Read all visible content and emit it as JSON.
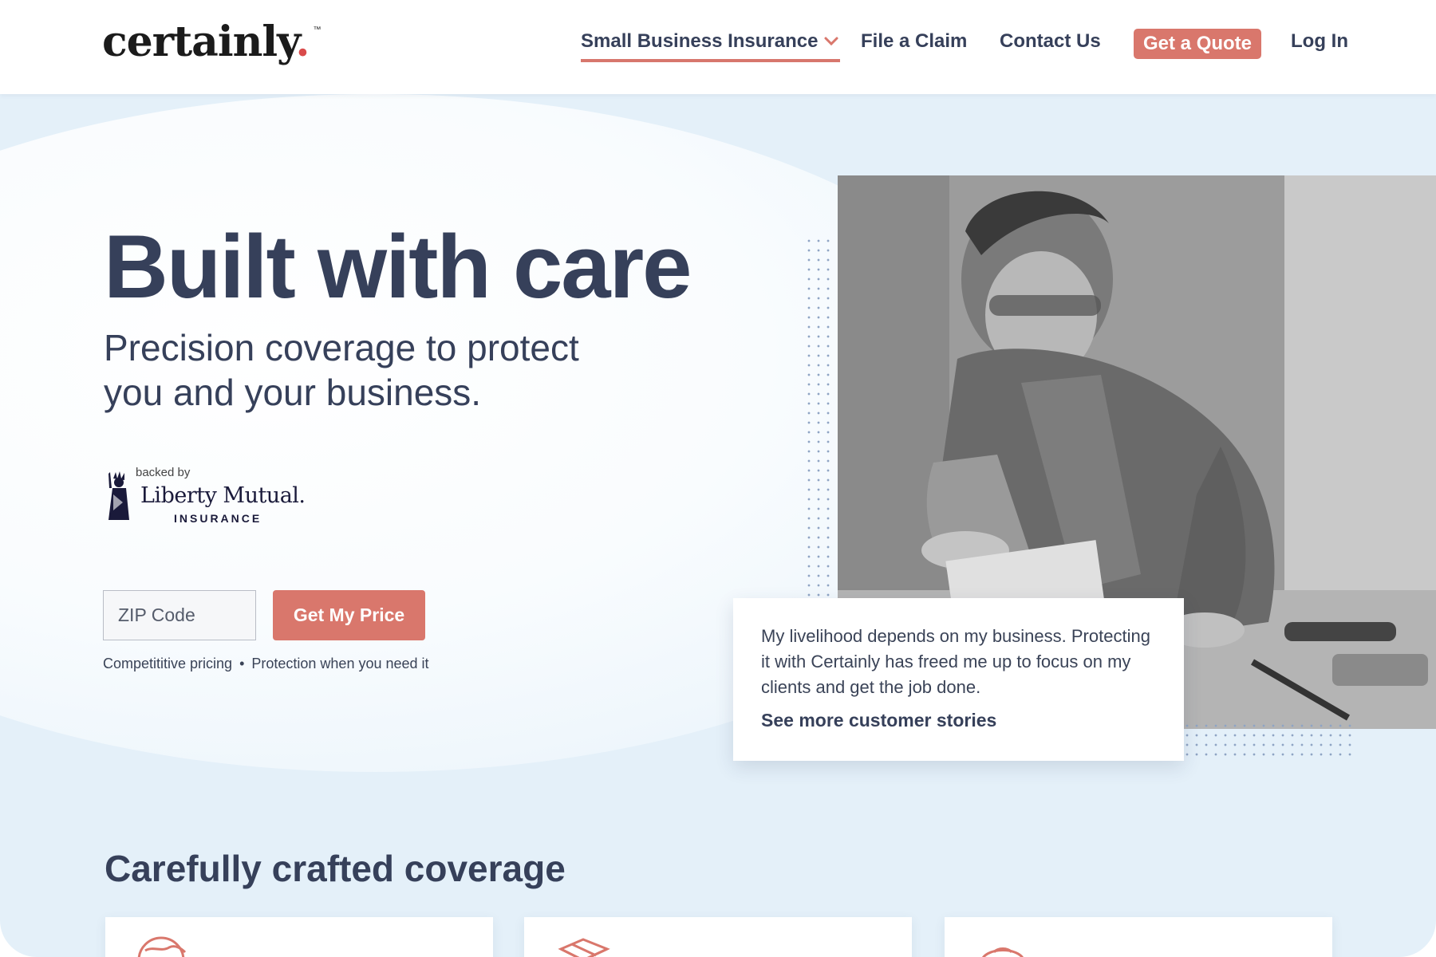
{
  "header": {
    "logo_text": "certainly",
    "logo_dot": ".",
    "logo_tm": "™",
    "nav": {
      "small_business": "Small Business Insurance",
      "file_claim": "File a Claim",
      "contact": "Contact Us",
      "get_quote": "Get a Quote",
      "login": "Log In"
    },
    "icons": {
      "dropdown": "chevron-down-icon"
    }
  },
  "hero": {
    "title": "Built with care",
    "subtitle": "Precision coverage to protect you and your business.",
    "backed_by": "backed by",
    "partner_name": "Liberty Mutual.",
    "partner_sub": "INSURANCE",
    "zip_placeholder": "ZIP Code",
    "zip_value": "",
    "cta": "Get My Price",
    "perk_1": "Competititive pricing",
    "perk_sep": "•",
    "perk_2": "Protection when you need it"
  },
  "testimonial": {
    "quote": "My livelihood depends on my business. Protecting it with Certainly has freed me up to focus on my clients and get the job done.",
    "link": "See more customer stories"
  },
  "coverage": {
    "heading": "Carefully crafted coverage",
    "cards": [
      {
        "icon": "globe-icon"
      },
      {
        "icon": "box-icon"
      },
      {
        "icon": "umbrella-icon"
      }
    ]
  },
  "colors": {
    "primary_text": "#36405a",
    "accent": "#d9776c",
    "background": "#e4f0f9"
  }
}
